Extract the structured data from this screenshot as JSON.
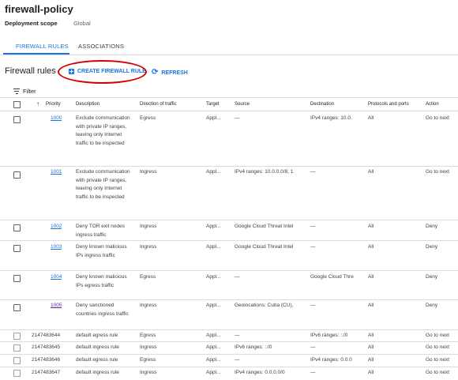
{
  "page": {
    "title": "firewall-policy",
    "scope_label": "Deployment scope",
    "scope_value": "Global"
  },
  "tabs": [
    {
      "label": "FIREWALL RULES",
      "active": true
    },
    {
      "label": "ASSOCIATIONS",
      "active": false
    }
  ],
  "section": {
    "title": "Firewall rules",
    "create_label": "CREATE FIREWALL RULE",
    "refresh_label": "REFRESH"
  },
  "filter": {
    "label": "Filter"
  },
  "table": {
    "headers": {
      "priority": "Priority",
      "description": "Description",
      "direction": "Direction of traffic",
      "target": "Target",
      "source": "Source",
      "destination": "Destination",
      "protocols": "Protocols and ports",
      "action": "Action"
    },
    "rows": [
      {
        "priority": "1000",
        "description": "Exclude communication with private IP ranges, leaving only Internet traffic to be inspected",
        "direction": "Egress",
        "target": "Appl...",
        "source": "—",
        "destination": "IPv4 ranges: 10.0.",
        "protocols": "All",
        "action": "Go to next"
      },
      {
        "priority": "1001",
        "description": "Exclude communication with private IP ranges, leaving only Internet traffic to be inspected",
        "direction": "Ingress",
        "target": "Appl...",
        "source": "IPv4 ranges: 10.0.0.0/8, 1",
        "destination": "—",
        "protocols": "All",
        "action": "Go to next"
      },
      {
        "priority": "1002",
        "description": "Deny TOR exit nodes ingress traffic",
        "direction": "Ingress",
        "target": "Appl...",
        "source": "Google Cloud Threat Intel",
        "destination": "—",
        "protocols": "All",
        "action": "Deny"
      },
      {
        "priority": "1003",
        "description": "Deny known malicious IPs ingress traffic",
        "direction": "Ingress",
        "target": "Appl...",
        "source": "Google Cloud Threat Intel",
        "destination": "—",
        "protocols": "All",
        "action": "Deny"
      },
      {
        "priority": "1004",
        "description": "Deny known malicious IPs egress traffic",
        "direction": "Egress",
        "target": "Appl...",
        "source": "—",
        "destination": "Google Cloud Thre",
        "protocols": "All",
        "action": "Deny"
      },
      {
        "priority": "1005",
        "description": "Deny sanctioned countries ingress traffic",
        "direction": "Ingress",
        "target": "Appl...",
        "source": "Geolocations: Cuba (CU),",
        "destination": "—",
        "protocols": "All",
        "action": "Deny"
      },
      {
        "priority": "2147483644",
        "description": "default egress rule",
        "direction": "Egress",
        "target": "Appl...",
        "source": "—",
        "destination": "IPv6 ranges: ::/0",
        "protocols": "All",
        "action": "Go to next"
      },
      {
        "priority": "2147483645",
        "description": "default ingress rule",
        "direction": "Ingress",
        "target": "Appl...",
        "source": "IPv6 ranges: ::/0",
        "destination": "—",
        "protocols": "All",
        "action": "Go to next"
      },
      {
        "priority": "2147483646",
        "description": "default egress rule",
        "direction": "Egress",
        "target": "Appl...",
        "source": "—",
        "destination": "IPv4 ranges: 0.0.0",
        "protocols": "All",
        "action": "Go to next"
      },
      {
        "priority": "2147483647",
        "description": "default ingress rule",
        "direction": "Ingress",
        "target": "Appl...",
        "source": "IPv4 ranges: 0.0.0.0/0",
        "destination": "—",
        "protocols": "All",
        "action": "Go to next"
      }
    ]
  },
  "colors": {
    "accent": "#1a73e8",
    "visited_link": "#681da8",
    "annotation": "#d50000"
  }
}
